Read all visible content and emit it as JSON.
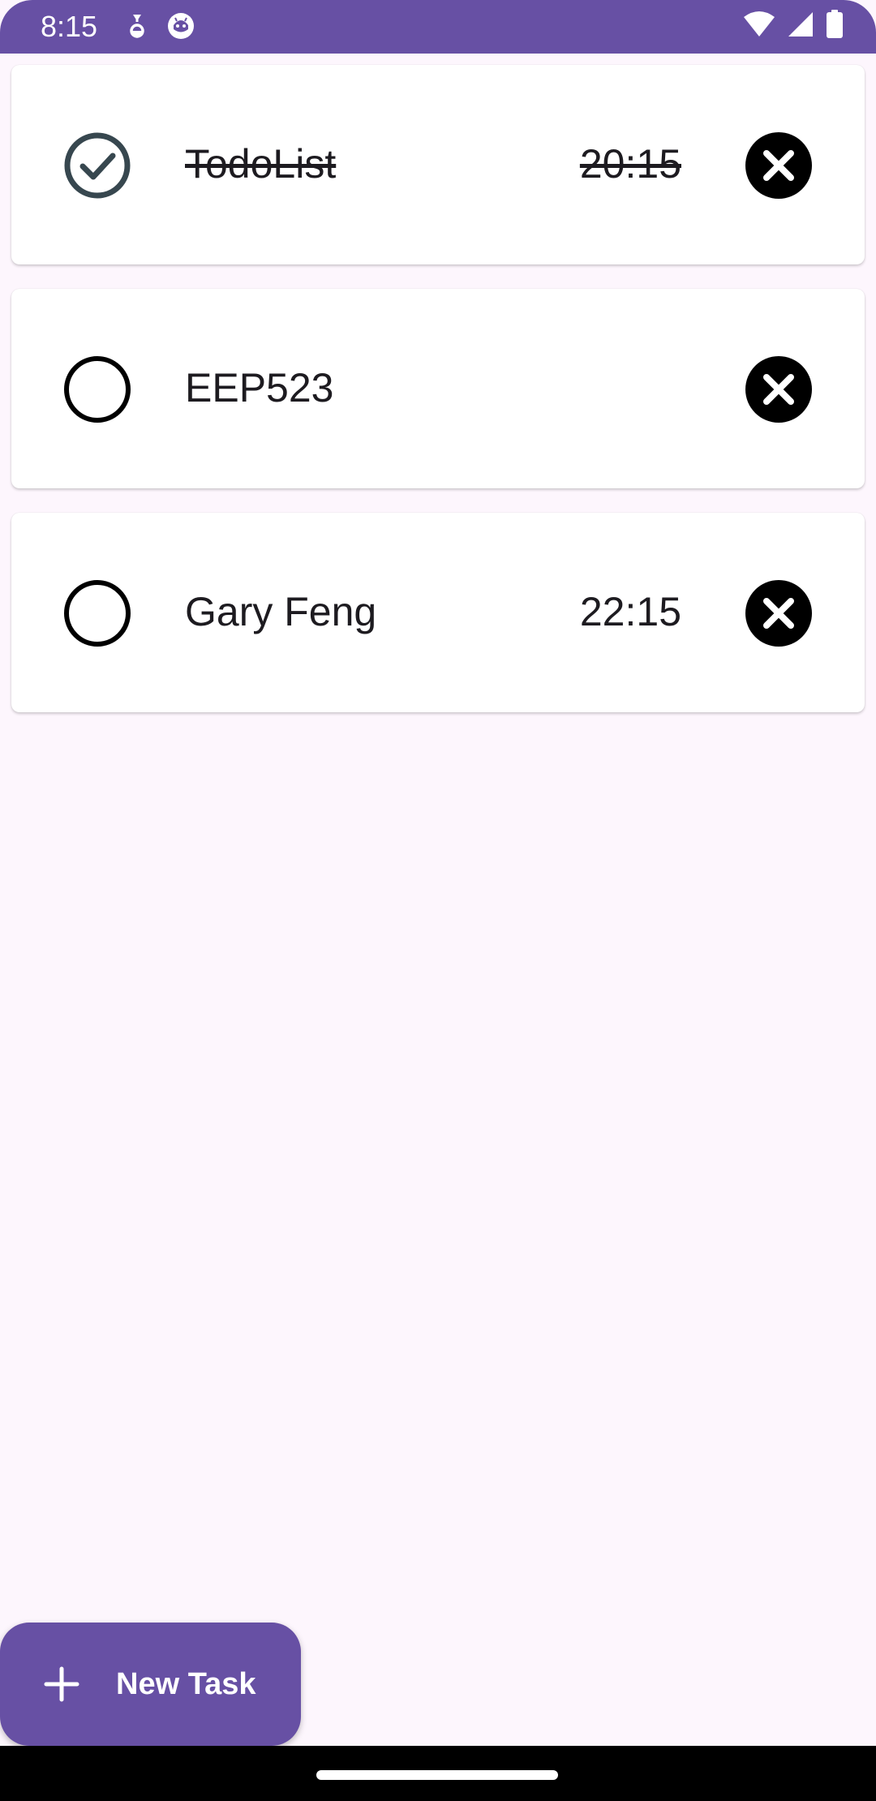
{
  "status_bar": {
    "time": "8:15",
    "icons_left": [
      "download-notification-icon",
      "android-debug-icon"
    ],
    "icons_right": [
      "wifi-icon",
      "cellular-signal-icon",
      "battery-icon"
    ],
    "background": "#6750A4"
  },
  "tasks": [
    {
      "title": "TodoList",
      "time": "20:15",
      "completed": true
    },
    {
      "title": "EEP523",
      "time": "",
      "completed": false
    },
    {
      "title": "Gary Feng",
      "time": "22:15",
      "completed": false
    }
  ],
  "fab": {
    "label": "New Task",
    "icon": "plus-icon",
    "background": "#6750A4"
  },
  "colors": {
    "page_background": "#FDF6FD",
    "accent": "#6750A4",
    "checked_icon": "#37474F"
  }
}
